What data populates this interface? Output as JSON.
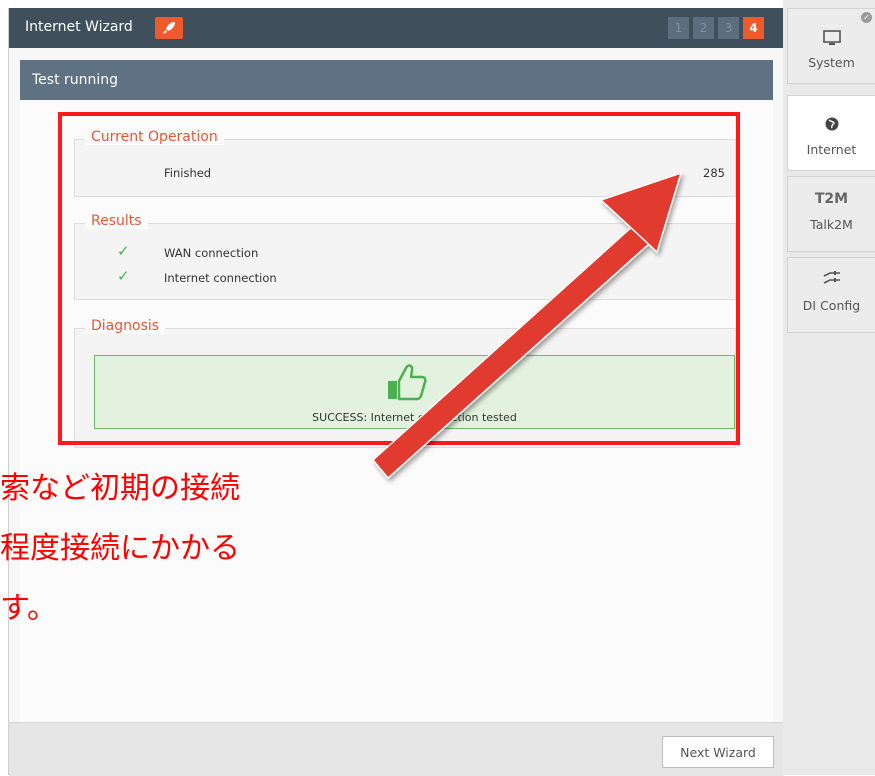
{
  "wizard": {
    "title": "Internet Wizard",
    "steps": [
      "1",
      "2",
      "3",
      "4"
    ],
    "active_step": "4"
  },
  "subheader": "Test running",
  "current_operation": {
    "legend": "Current Operation",
    "status": "Finished",
    "value": "285"
  },
  "results": {
    "legend": "Results",
    "items": [
      "WAN connection",
      "Internet connection"
    ]
  },
  "diagnosis": {
    "legend": "Diagnosis",
    "message": "SUCCESS: Internet connection tested"
  },
  "annotation": {
    "lines": [
      "索など初期の接続",
      "程度接続にかかる",
      "す。"
    ]
  },
  "footer": {
    "next_label": "Next Wizard"
  },
  "sidebar": {
    "tabs": [
      {
        "label": "System",
        "icon": "monitor-icon"
      },
      {
        "label": "Internet",
        "icon": "globe-icon"
      },
      {
        "label": "Talk2M",
        "icon": "t2m-logo-icon",
        "logo_text": "T2M"
      },
      {
        "label": "DI Config",
        "icon": "sliders-icon"
      }
    ]
  },
  "colors": {
    "accent": "#ef5a2b",
    "topbar": "#3f4f5b",
    "annotation_red": "#ff1a1a",
    "success_green": "#4caf50"
  }
}
